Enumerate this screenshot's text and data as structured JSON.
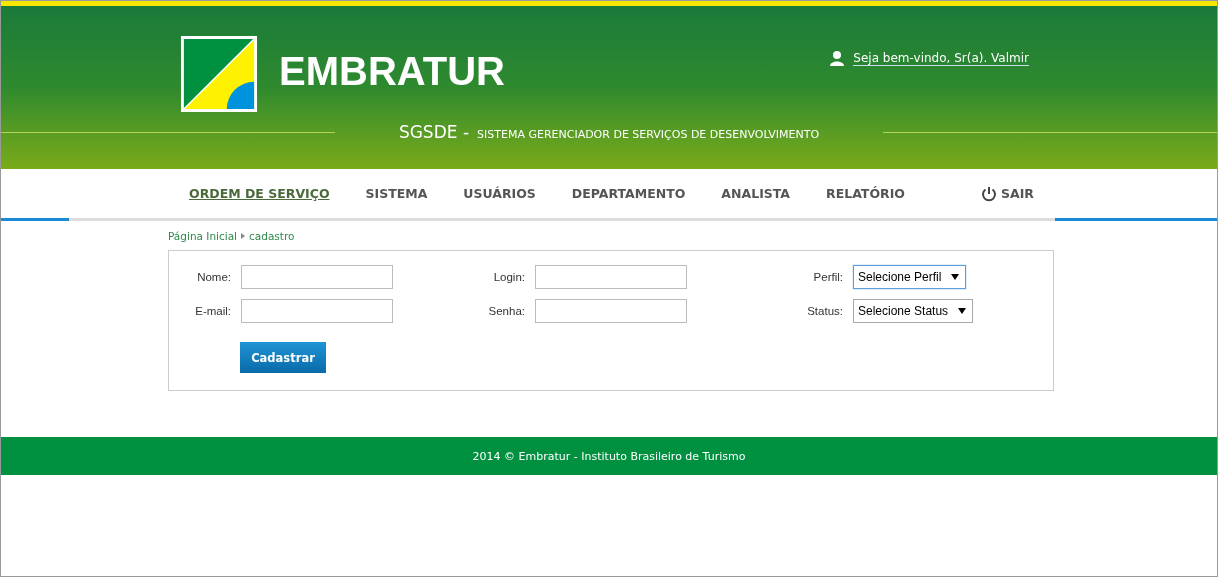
{
  "header": {
    "logo_text": "EMBRATUR",
    "welcome": "Seja bem-vindo, Sr(a). Valmir",
    "system_acronym": "SGSDE -",
    "system_name": "SISTEMA GERENCIADOR DE SERVIÇOS DE DESENVOLVIMENTO"
  },
  "nav": {
    "items": [
      {
        "label": "ORDEM DE SERVIÇO",
        "selected": true
      },
      {
        "label": "SISTEMA",
        "selected": false
      },
      {
        "label": "USUÁRIOS",
        "selected": false
      },
      {
        "label": "DEPARTAMENTO",
        "selected": false
      },
      {
        "label": "ANALISTA",
        "selected": false
      },
      {
        "label": "RELATÓRIO",
        "selected": false
      }
    ],
    "logout": "SAIR"
  },
  "breadcrumb": [
    "Página Inicial",
    "cadastro"
  ],
  "form": {
    "fields": [
      {
        "label": "Nome:",
        "kind": "text",
        "focused": false
      },
      {
        "label": "Login:",
        "kind": "text",
        "focused": false
      },
      {
        "label": "Perfil:",
        "kind": "select",
        "value": "Selecione Perfil",
        "focused": true
      },
      {
        "label": "E-mail:",
        "kind": "text",
        "focused": false
      },
      {
        "label": "Senha:",
        "kind": "text",
        "focused": false
      },
      {
        "label": "Status:",
        "kind": "select",
        "value": "Selecione Status",
        "focused": false
      }
    ],
    "submit": "Cadastrar"
  },
  "footer": "2014 © Embratur - Instituto Brasileiro de Turismo"
}
